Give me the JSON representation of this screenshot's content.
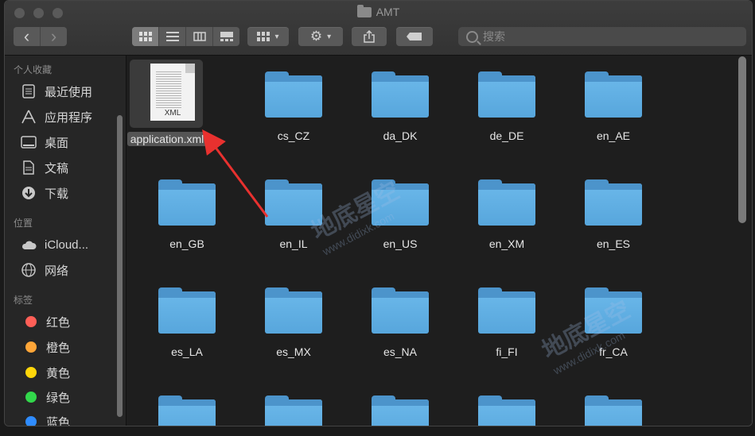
{
  "window": {
    "title": "AMT"
  },
  "toolbar": {
    "back": "‹",
    "forward": "›",
    "search_placeholder": "搜索"
  },
  "sidebar": {
    "favorites_header": "个人收藏",
    "favorites": [
      {
        "label": "最近使用",
        "icon": "recents-icon"
      },
      {
        "label": "应用程序",
        "icon": "applications-icon"
      },
      {
        "label": "桌面",
        "icon": "desktop-icon"
      },
      {
        "label": "文稿",
        "icon": "documents-icon"
      },
      {
        "label": "下载",
        "icon": "downloads-icon"
      }
    ],
    "locations_header": "位置",
    "locations": [
      {
        "label": "iCloud...",
        "icon": "icloud-icon"
      },
      {
        "label": "网络",
        "icon": "network-icon"
      }
    ],
    "tags_header": "标签",
    "tags": [
      {
        "label": "红色",
        "color": "#ff5f57"
      },
      {
        "label": "橙色",
        "color": "#ffa638"
      },
      {
        "label": "黄色",
        "color": "#ffd60a"
      },
      {
        "label": "绿色",
        "color": "#32d74b"
      },
      {
        "label": "蓝色",
        "color": "#2f8cff"
      }
    ]
  },
  "files": [
    {
      "name": "application.xml",
      "kind": "xml",
      "badge": "XML"
    },
    {
      "name": "cs_CZ"
    },
    {
      "name": "da_DK"
    },
    {
      "name": "de_DE"
    },
    {
      "name": "en_AE"
    },
    {
      "name": "en_GB"
    },
    {
      "name": "en_IL"
    },
    {
      "name": "en_US"
    },
    {
      "name": "en_XM"
    },
    {
      "name": "en_ES"
    },
    {
      "name": "es_LA"
    },
    {
      "name": "es_MX"
    },
    {
      "name": "es_NA"
    },
    {
      "name": "fi_FI"
    },
    {
      "name": "fr_CA"
    }
  ],
  "watermark": {
    "text": "地底星空",
    "url": "www.didixk.com"
  },
  "colors": {
    "folder": "#5aa9de",
    "selection": "#555555"
  }
}
